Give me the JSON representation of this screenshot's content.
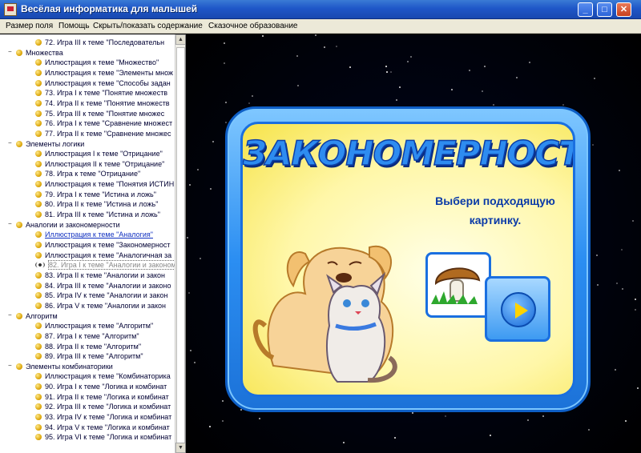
{
  "window": {
    "title": "Весёлая информатика для малышей"
  },
  "menu": {
    "items": [
      "Размер поля",
      "Помощь",
      "Скрыть/показать содержание",
      "Сказочное образование"
    ]
  },
  "tree": [
    {
      "type": "leaf",
      "label": "72. Игра III к теме \"Последовательн"
    },
    {
      "type": "cat",
      "label": "Множества"
    },
    {
      "type": "leaf",
      "label": "Иллюстрация к теме \"Множество\""
    },
    {
      "type": "leaf",
      "label": "Иллюстрация к теме \"Элементы множ"
    },
    {
      "type": "leaf",
      "label": "Иллюстрация к теме \"Способы задан"
    },
    {
      "type": "leaf",
      "label": "73. Игра I к теме \"Понятие множеств"
    },
    {
      "type": "leaf",
      "label": "74. Игра II к теме \"Понятие множеств"
    },
    {
      "type": "leaf",
      "label": "75. Игра III к теме \"Понятие множес"
    },
    {
      "type": "leaf",
      "label": "76. Игра I к теме \"Сравнение множест"
    },
    {
      "type": "leaf",
      "label": "77. Игра II к теме \"Сравнение множес"
    },
    {
      "type": "cat",
      "label": "Элементы логики"
    },
    {
      "type": "leaf",
      "label": "Иллюстрация I к теме \"Отрицание\""
    },
    {
      "type": "leaf",
      "label": "Иллюстрация II к теме \"Отрицание\""
    },
    {
      "type": "leaf",
      "label": "78. Игра к теме \"Отрицание\""
    },
    {
      "type": "leaf",
      "label": "Иллюстрация к теме \"Понятия ИСТИН"
    },
    {
      "type": "leaf",
      "label": "79. Игра I к теме \"Истина и ложь\""
    },
    {
      "type": "leaf",
      "label": "80. Игра II к теме \"Истина и ложь\""
    },
    {
      "type": "leaf",
      "label": "81. Игра III к теме \"Истина и ложь\""
    },
    {
      "type": "cat",
      "label": "Аналогии и закономерности"
    },
    {
      "type": "leaf",
      "label": "Иллюстрация к теме \"Аналогия\"",
      "state": "link"
    },
    {
      "type": "leaf",
      "label": "Иллюстрация к теме \"Закономерност"
    },
    {
      "type": "leaf",
      "label": "Иллюстрация к теме \"Аналогичная за"
    },
    {
      "type": "leaf",
      "label": "82. Игра I к теме \"Аналогии и законом",
      "state": "selected"
    },
    {
      "type": "leaf",
      "label": "83. Игра II к теме \"Аналогии и закон"
    },
    {
      "type": "leaf",
      "label": "84. Игра III к теме \"Аналогии и законо"
    },
    {
      "type": "leaf",
      "label": "85. Игра IV к теме \"Аналогии и закон"
    },
    {
      "type": "leaf",
      "label": "86. Игра V к теме \"Аналогии и закон"
    },
    {
      "type": "cat",
      "label": "Алгоритм"
    },
    {
      "type": "leaf",
      "label": "Иллюстрация к теме \"Алгоритм\""
    },
    {
      "type": "leaf",
      "label": "87. Игра I к теме \"Алгоритм\""
    },
    {
      "type": "leaf",
      "label": "88. Игра II к теме \"Алгоритм\""
    },
    {
      "type": "leaf",
      "label": "89. Игра III к теме \"Алгоритм\""
    },
    {
      "type": "cat",
      "label": "Элементы комбинаторики"
    },
    {
      "type": "leaf",
      "label": "Иллюстрация к теме \"Комбинаторика"
    },
    {
      "type": "leaf",
      "label": "90. Игра I к теме \"Логика и комбинат"
    },
    {
      "type": "leaf",
      "label": "91. Игра II к теме \"Логика и комбинат"
    },
    {
      "type": "leaf",
      "label": "92. Игра III к теме \"Логика и комбинат"
    },
    {
      "type": "leaf",
      "label": "93. Игра IV к теме \"Логика и комбинат"
    },
    {
      "type": "leaf",
      "label": "94. Игра V к теме \"Логика и комбинат"
    },
    {
      "type": "leaf",
      "label": "95. Игра VI к теме \"Логика и комбинат"
    }
  ],
  "game": {
    "title": "ЗАКОНОМЕРНОСТИ",
    "instruction_line1": "Выбери подходящую",
    "instruction_line2": "картинку."
  }
}
